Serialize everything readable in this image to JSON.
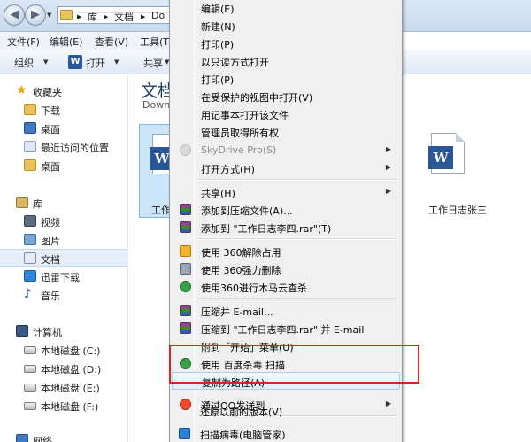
{
  "address": {
    "crumbs": [
      "库",
      "文档",
      "Do"
    ]
  },
  "menubar": {
    "file": "文件(F)",
    "edit": "编辑(E)",
    "view": "查看(V)",
    "tools": "工具(T)"
  },
  "toolbar": {
    "organize": "组织",
    "open": "打开",
    "share": "共享"
  },
  "nav": {
    "favorites": "收藏夹",
    "downloads": "下载",
    "desktop": "桌面",
    "recent": "最近访问的位置",
    "desktop2": "桌面",
    "libraries": "库",
    "videos": "视频",
    "pictures": "图片",
    "documents": "文档",
    "thunder": "迅雷下载",
    "music": "音乐",
    "computer": "计算机",
    "drive_c": "本地磁盘 (C:)",
    "drive_d": "本地磁盘 (D:)",
    "drive_e": "本地磁盘 (E:)",
    "drive_f": "本地磁盘 (F:)",
    "network": "网络"
  },
  "content": {
    "title": "文档",
    "subtitle": "Downl",
    "file_a_label": "工作",
    "file_b_label": "工作日志张三"
  },
  "context_menu": {
    "items": [
      "编辑(E)",
      "新建(N)",
      "打印(P)",
      "以只读方式打开",
      "打印(P)",
      "在受保护的视图中打开(V)",
      "用记事本打开该文件",
      "管理员取得所有权",
      "SkyDrive Pro(S)",
      "打开方式(H)",
      "共享(H)",
      "添加到压缩文件(A)...",
      "添加到 \"工作日志李四.rar\"(T)",
      "使用 360解除占用",
      "使用 360强力删除",
      "使用360进行木马云查杀",
      "压缩并 E-mail...",
      "压缩到 \"工作日志李四.rar\" 并 E-mail",
      "附到「开始」菜单(U)",
      "使用 百度杀毒 扫描",
      "复制为路径(A)",
      "通过QQ发送到",
      "还原以前的版本(V)",
      "扫描病毒(电脑管家)"
    ]
  },
  "colors": {
    "highlight_box": "#e0201a",
    "word_blue": "#2b5797",
    "selection": "#cce4f7"
  }
}
